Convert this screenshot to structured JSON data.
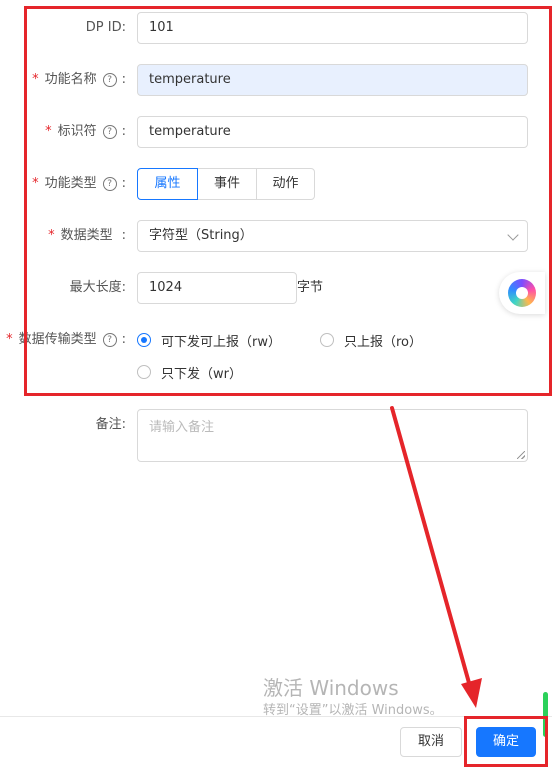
{
  "form": {
    "dp_id": {
      "label": "DP ID:",
      "value": "101"
    },
    "function_name": {
      "required_mark": "*",
      "label": "功能名称",
      "help": "?",
      "colon": ":",
      "value": "temperature"
    },
    "identifier": {
      "required_mark": "*",
      "label": "标识符",
      "help": "?",
      "colon": ":",
      "value": "temperature"
    },
    "function_type": {
      "required_mark": "*",
      "label": "功能类型",
      "help": "?",
      "colon": ":",
      "options": [
        "属性",
        "事件",
        "动作"
      ],
      "selected": "属性"
    },
    "data_type": {
      "required_mark": "*",
      "label": "数据类型",
      "colon": ":",
      "value": "字符型（String）"
    },
    "max_length": {
      "label": "最大长度:",
      "value": "1024",
      "suffix": "字节"
    },
    "transfer_type": {
      "required_mark": "*",
      "label": "数据传输类型",
      "help": "?",
      "colon": ":",
      "options": [
        {
          "label": "可下发可上报（rw）",
          "checked": true
        },
        {
          "label": "只上报（ro）",
          "checked": false
        },
        {
          "label": "只下发（wr）",
          "checked": false
        }
      ]
    },
    "remark": {
      "label": "备注:",
      "placeholder": "请输入备注"
    }
  },
  "footer": {
    "cancel_label": "取消",
    "ok_label": "确定"
  },
  "watermark": {
    "line1": "激活 Windows",
    "line2": "转到“设置”以激活 Windows。"
  },
  "floating_widget": {
    "icon": "assistant-orb-icon"
  },
  "colors": {
    "primary": "#1677ff",
    "annotation_red": "#e5252a",
    "autofill": "#e8f0fe",
    "scrollbar": "#2bd15a"
  }
}
